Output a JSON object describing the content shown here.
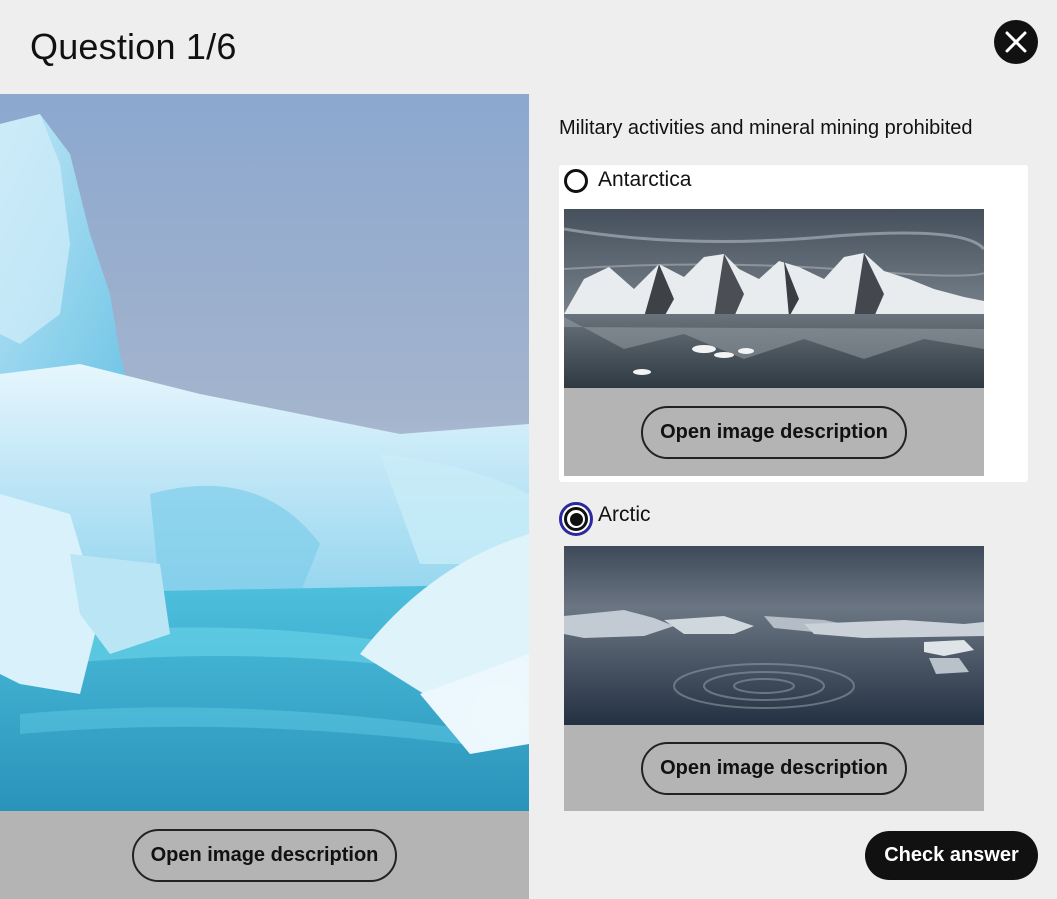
{
  "header": {
    "title": "Question 1/6",
    "close_icon": "close-icon"
  },
  "hero": {
    "image_icon": "iceberg-photo",
    "description_button": "Open image description"
  },
  "question": {
    "prompt": "Military activities and mineral mining prohibited"
  },
  "options": [
    {
      "label": "Antarctica",
      "selected": false,
      "image_icon": "mountains-photo",
      "description_button": "Open image description"
    },
    {
      "label": "Arctic",
      "selected": true,
      "image_icon": "sea-ice-photo",
      "description_button": "Open image description"
    }
  ],
  "footer": {
    "check_button": "Check answer"
  },
  "colors": {
    "background": "#eeeeee",
    "primary": "#111111",
    "focus_ring": "#2a2aa0",
    "footer_gray": "#b4b4b4"
  }
}
